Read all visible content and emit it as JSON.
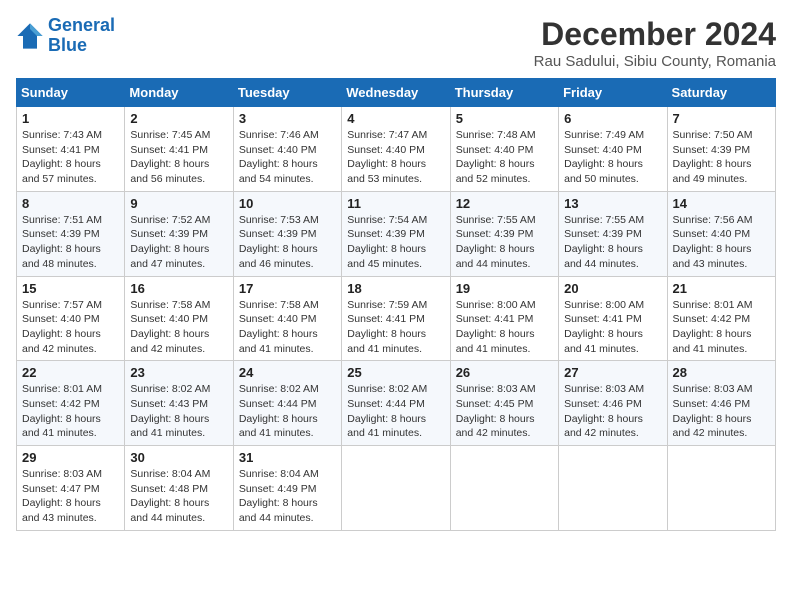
{
  "header": {
    "logo_line1": "General",
    "logo_line2": "Blue",
    "month_title": "December 2024",
    "location": "Rau Sadului, Sibiu County, Romania"
  },
  "weekdays": [
    "Sunday",
    "Monday",
    "Tuesday",
    "Wednesday",
    "Thursday",
    "Friday",
    "Saturday"
  ],
  "weeks": [
    [
      {
        "day": "1",
        "sunrise": "7:43 AM",
        "sunset": "4:41 PM",
        "daylight": "8 hours and 57 minutes."
      },
      {
        "day": "2",
        "sunrise": "7:45 AM",
        "sunset": "4:41 PM",
        "daylight": "8 hours and 56 minutes."
      },
      {
        "day": "3",
        "sunrise": "7:46 AM",
        "sunset": "4:40 PM",
        "daylight": "8 hours and 54 minutes."
      },
      {
        "day": "4",
        "sunrise": "7:47 AM",
        "sunset": "4:40 PM",
        "daylight": "8 hours and 53 minutes."
      },
      {
        "day": "5",
        "sunrise": "7:48 AM",
        "sunset": "4:40 PM",
        "daylight": "8 hours and 52 minutes."
      },
      {
        "day": "6",
        "sunrise": "7:49 AM",
        "sunset": "4:40 PM",
        "daylight": "8 hours and 50 minutes."
      },
      {
        "day": "7",
        "sunrise": "7:50 AM",
        "sunset": "4:39 PM",
        "daylight": "8 hours and 49 minutes."
      }
    ],
    [
      {
        "day": "8",
        "sunrise": "7:51 AM",
        "sunset": "4:39 PM",
        "daylight": "8 hours and 48 minutes."
      },
      {
        "day": "9",
        "sunrise": "7:52 AM",
        "sunset": "4:39 PM",
        "daylight": "8 hours and 47 minutes."
      },
      {
        "day": "10",
        "sunrise": "7:53 AM",
        "sunset": "4:39 PM",
        "daylight": "8 hours and 46 minutes."
      },
      {
        "day": "11",
        "sunrise": "7:54 AM",
        "sunset": "4:39 PM",
        "daylight": "8 hours and 45 minutes."
      },
      {
        "day": "12",
        "sunrise": "7:55 AM",
        "sunset": "4:39 PM",
        "daylight": "8 hours and 44 minutes."
      },
      {
        "day": "13",
        "sunrise": "7:55 AM",
        "sunset": "4:39 PM",
        "daylight": "8 hours and 44 minutes."
      },
      {
        "day": "14",
        "sunrise": "7:56 AM",
        "sunset": "4:40 PM",
        "daylight": "8 hours and 43 minutes."
      }
    ],
    [
      {
        "day": "15",
        "sunrise": "7:57 AM",
        "sunset": "4:40 PM",
        "daylight": "8 hours and 42 minutes."
      },
      {
        "day": "16",
        "sunrise": "7:58 AM",
        "sunset": "4:40 PM",
        "daylight": "8 hours and 42 minutes."
      },
      {
        "day": "17",
        "sunrise": "7:58 AM",
        "sunset": "4:40 PM",
        "daylight": "8 hours and 41 minutes."
      },
      {
        "day": "18",
        "sunrise": "7:59 AM",
        "sunset": "4:41 PM",
        "daylight": "8 hours and 41 minutes."
      },
      {
        "day": "19",
        "sunrise": "8:00 AM",
        "sunset": "4:41 PM",
        "daylight": "8 hours and 41 minutes."
      },
      {
        "day": "20",
        "sunrise": "8:00 AM",
        "sunset": "4:41 PM",
        "daylight": "8 hours and 41 minutes."
      },
      {
        "day": "21",
        "sunrise": "8:01 AM",
        "sunset": "4:42 PM",
        "daylight": "8 hours and 41 minutes."
      }
    ],
    [
      {
        "day": "22",
        "sunrise": "8:01 AM",
        "sunset": "4:42 PM",
        "daylight": "8 hours and 41 minutes."
      },
      {
        "day": "23",
        "sunrise": "8:02 AM",
        "sunset": "4:43 PM",
        "daylight": "8 hours and 41 minutes."
      },
      {
        "day": "24",
        "sunrise": "8:02 AM",
        "sunset": "4:44 PM",
        "daylight": "8 hours and 41 minutes."
      },
      {
        "day": "25",
        "sunrise": "8:02 AM",
        "sunset": "4:44 PM",
        "daylight": "8 hours and 41 minutes."
      },
      {
        "day": "26",
        "sunrise": "8:03 AM",
        "sunset": "4:45 PM",
        "daylight": "8 hours and 42 minutes."
      },
      {
        "day": "27",
        "sunrise": "8:03 AM",
        "sunset": "4:46 PM",
        "daylight": "8 hours and 42 minutes."
      },
      {
        "day": "28",
        "sunrise": "8:03 AM",
        "sunset": "4:46 PM",
        "daylight": "8 hours and 42 minutes."
      }
    ],
    [
      {
        "day": "29",
        "sunrise": "8:03 AM",
        "sunset": "4:47 PM",
        "daylight": "8 hours and 43 minutes."
      },
      {
        "day": "30",
        "sunrise": "8:04 AM",
        "sunset": "4:48 PM",
        "daylight": "8 hours and 44 minutes."
      },
      {
        "day": "31",
        "sunrise": "8:04 AM",
        "sunset": "4:49 PM",
        "daylight": "8 hours and 44 minutes."
      },
      null,
      null,
      null,
      null
    ]
  ],
  "labels": {
    "sunrise": "Sunrise:",
    "sunset": "Sunset:",
    "daylight": "Daylight:"
  }
}
